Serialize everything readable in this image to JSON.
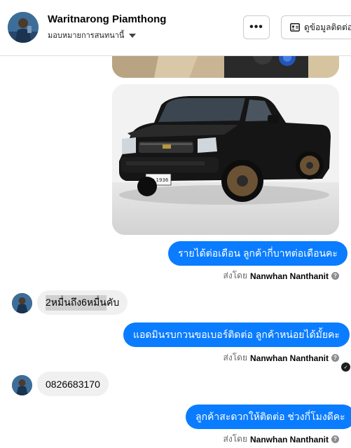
{
  "header": {
    "name": "Waritnarong Piamthong",
    "subtitle": "มอบหมายการสนทนานี้",
    "more_label": "•••",
    "contact_label": "ดูข้อมูลติดต่อ"
  },
  "messages": {
    "out1": "รายได้ต่อเดือน ลูกค้ากี่บาทต่อเดือนคะ",
    "in1_highlight": "2หมื่นถึง6หมื่น",
    "in1_rest": "คับ",
    "out2": "แอดมินรบกวนขอเบอร์ติดต่อ ลูกค้าหน่อยได้มั้ยคะ",
    "in2": "0826683170",
    "out3": "ลูกค้าสะดวกให้ติดต่อ ช่วงกี่โมงดีคะ"
  },
  "sent_by": {
    "prefix": "ส่งโดย",
    "name": "Nanwhan Nanthanit"
  },
  "car_plate": "ผท 1936",
  "icons": [
    "avatar",
    "chevron-down-icon",
    "more-icon",
    "contact-card-icon",
    "info-icon",
    "seen-icon"
  ],
  "colors": {
    "outgoing": "#0a7cff",
    "incoming": "#f0f0f0"
  }
}
